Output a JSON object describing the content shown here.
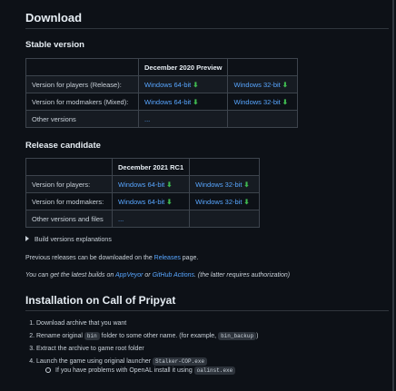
{
  "download": {
    "title": "Download",
    "stable": {
      "title": "Stable version",
      "header": "December 2020 Preview",
      "rows": [
        {
          "label": "Version for players (Release):",
          "win64": "Windows 64-bit",
          "win32": "Windows 32-bit"
        },
        {
          "label": "Version for modmakers (Mixed):",
          "win64": "Windows 64-bit",
          "win32": "Windows 32-bit"
        }
      ],
      "other_label": "Other versions",
      "other_link": "..."
    },
    "rc": {
      "title": "Release candidate",
      "header": "December 2021 RC1",
      "rows": [
        {
          "label": "Version for players:",
          "win64": "Windows 64-bit",
          "win32": "Windows 32-bit"
        },
        {
          "label": "Version for modmakers:",
          "win64": "Windows 64-bit",
          "win32": "Windows 32-bit"
        }
      ],
      "other_label": "Other versions and files",
      "other_link": "..."
    },
    "download_glyph": "⬇",
    "build_explanations": "Build versions explanations",
    "previous": {
      "pre": "Previous releases can be downloaded on the ",
      "link": "Releases",
      "post": " page."
    },
    "latest": {
      "pre": "You can get the latest builds on ",
      "link1": "AppVeyor",
      "mid": " or ",
      "link2": "GitHub Actions",
      "post": ". (the latter requires authorization)"
    }
  },
  "installation": {
    "title": "Installation on Call of Pripyat",
    "steps": [
      {
        "text": "Download archive that you want"
      },
      {
        "pre": "Rename original ",
        "code": "bin",
        "mid": " folder to some other name. (for example, ",
        "code2": "bin_backup",
        "post": ")"
      },
      {
        "text": "Extract the archive to game root folder"
      },
      {
        "pre": "Launch the game using original launcher ",
        "code": "Stalker-COP.exe"
      }
    ],
    "substep": {
      "pre": "If you have problems with OpenAL install it using ",
      "code": "oalinst.exe"
    }
  },
  "colors": {
    "background": "#0d1117",
    "link": "#58a6ff",
    "download_icon": "#3fb950",
    "heading": "#e6edf3"
  }
}
